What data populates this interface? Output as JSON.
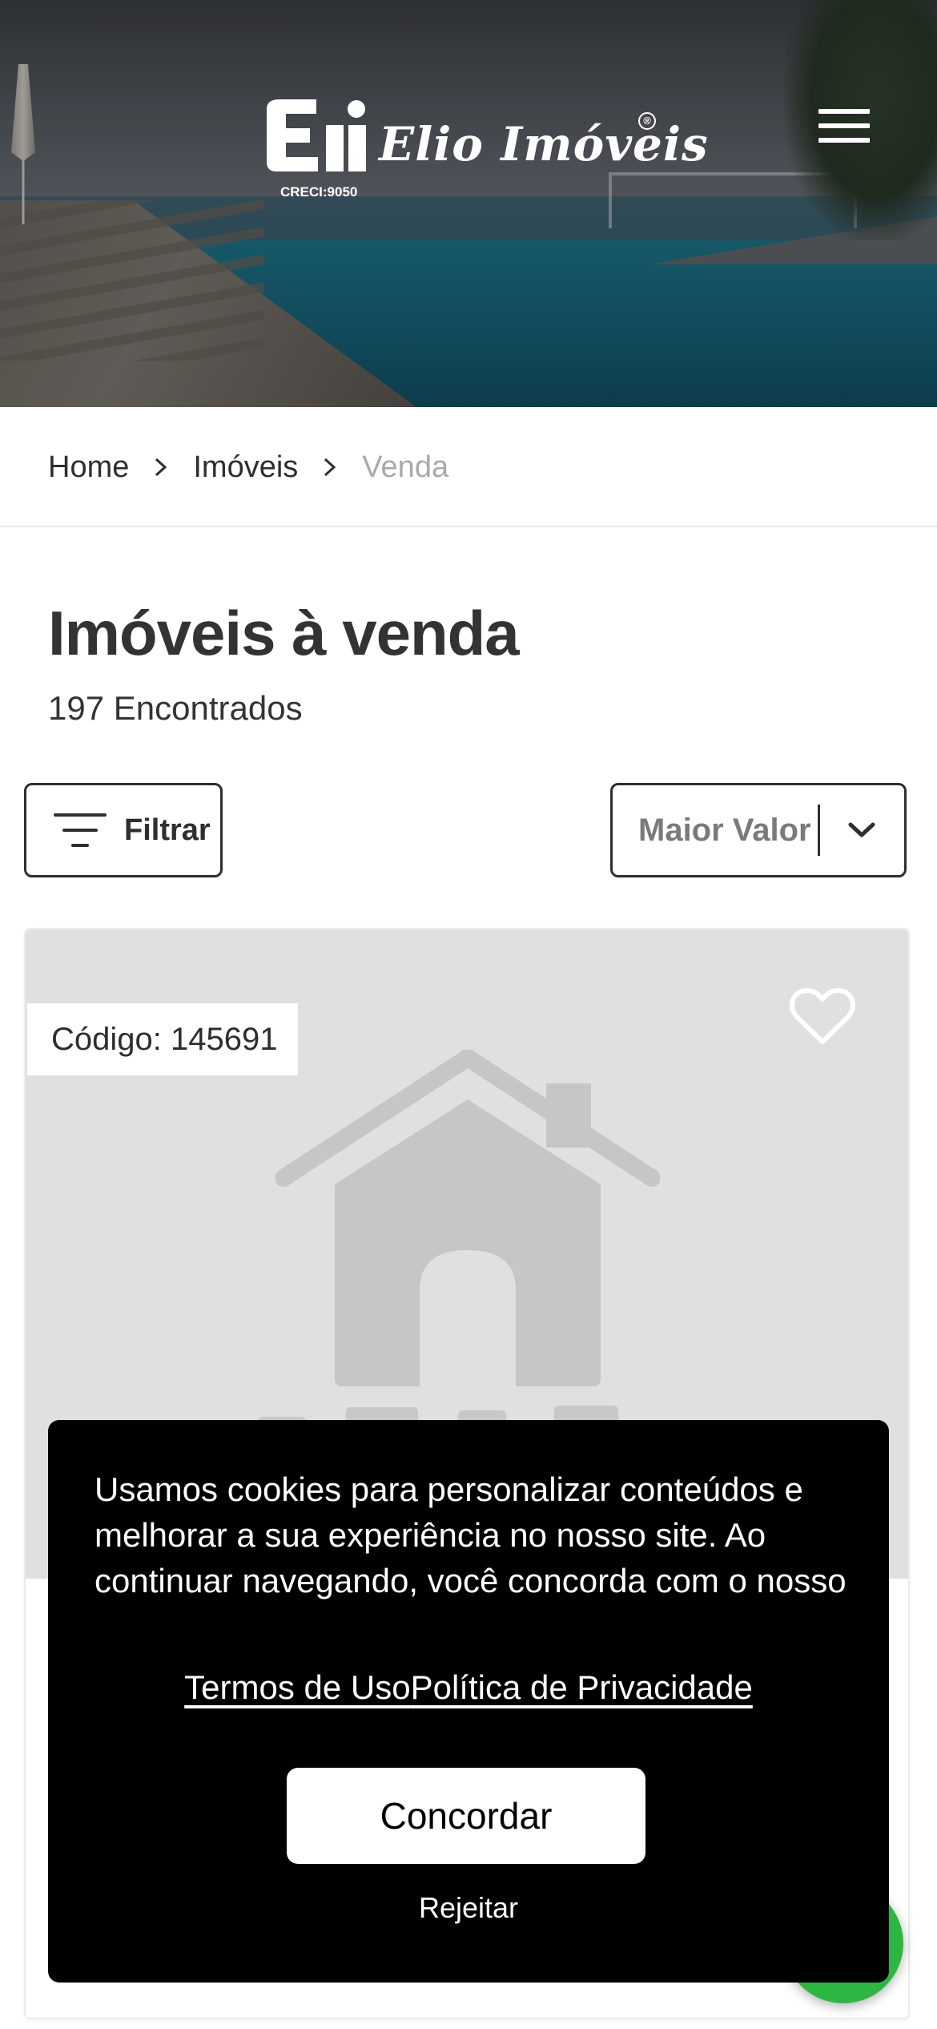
{
  "header": {
    "logo_text": "Elio Imóveis",
    "logo_creci": "CRECI:9050",
    "logo_registered": "®",
    "menu_icon": "hamburger-menu-icon"
  },
  "breadcrumb": {
    "items": [
      {
        "label": "Home"
      },
      {
        "label": "Imóveis"
      },
      {
        "label": "Venda"
      }
    ],
    "separator_icon": "chevron-right-icon"
  },
  "listing": {
    "title": "Imóveis à venda",
    "count_text": "197 Encontrados"
  },
  "controls": {
    "filter_label": "Filtrar",
    "filter_icon": "filter-lines-icon",
    "sort_value": "Maior Valor",
    "sort_icon": "chevron-down-icon"
  },
  "card": {
    "code_label": "Código: 145691",
    "favorite_icon": "heart-outline-icon",
    "placeholder_icon": "house-placeholder-icon"
  },
  "cookie_banner": {
    "message": "Usamos cookies para personalizar conteúdos e melhorar a sua experiência no nosso site. Ao continuar navegando, você concorda com o nosso",
    "terms_link": "Termos de Uso",
    "privacy_link": "Política de Privacidade",
    "agree_label": "Concordar",
    "reject_label": "Rejeitar"
  },
  "floating": {
    "whatsapp_icon": "whatsapp-icon"
  },
  "colors": {
    "text_primary": "#333333",
    "text_muted": "#a9a9a9",
    "sort_value": "#7a7a7a",
    "cookie_bg": "#000000",
    "placeholder_bg": "#e0e0e0",
    "whatsapp": "#2db742"
  }
}
